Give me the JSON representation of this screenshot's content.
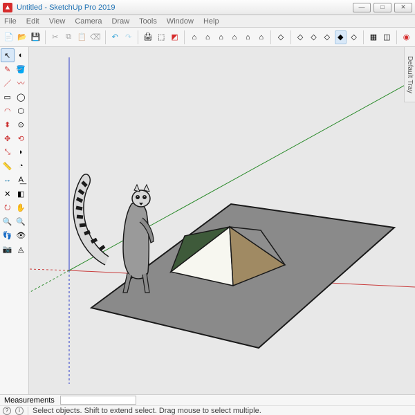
{
  "title": "Untitled - SketchUp Pro 2019",
  "menu": [
    "File",
    "Edit",
    "View",
    "Camera",
    "Draw",
    "Tools",
    "Window",
    "Help"
  ],
  "tray_label": "Default Tray",
  "measurements_label": "Measurements",
  "measurements_value": "",
  "status_hint": "Select objects. Shift to extend select. Drag mouse to select multiple.",
  "win_buttons": {
    "min": "—",
    "max": "□",
    "close": "✕"
  },
  "top_toolbar": [
    {
      "n": "new-icon",
      "g": "📄"
    },
    {
      "n": "open-icon",
      "g": "📂"
    },
    {
      "n": "save-icon",
      "g": "💾"
    },
    {
      "sep": true
    },
    {
      "n": "cut-icon",
      "g": "✂",
      "d": true
    },
    {
      "n": "copy-icon",
      "g": "⧉",
      "d": true
    },
    {
      "n": "paste-icon",
      "g": "📋",
      "d": true
    },
    {
      "n": "erase-icon",
      "g": "⌫",
      "d": true
    },
    {
      "sep": true
    },
    {
      "n": "undo-icon",
      "g": "↶",
      "c": "#2a9fd6"
    },
    {
      "n": "redo-icon",
      "g": "↷",
      "c": "#2a9fd6",
      "d": true
    },
    {
      "sep": true
    },
    {
      "n": "print-icon",
      "g": "🖨"
    },
    {
      "n": "model-info-icon",
      "g": "⬚"
    },
    {
      "n": "extension-icon",
      "g": "◩",
      "c": "#d62c2c"
    },
    {
      "sep": true
    },
    {
      "n": "warehouse-icon",
      "g": "⌂"
    },
    {
      "n": "3dwarehouse-icon",
      "g": "⌂"
    },
    {
      "n": "ext-warehouse-icon",
      "g": "⌂"
    },
    {
      "n": "component-icon",
      "g": "⌂"
    },
    {
      "n": "send-layout-icon",
      "g": "⌂"
    },
    {
      "n": "add-location-icon",
      "g": "⌂"
    },
    {
      "sep": true
    },
    {
      "n": "solid-tools-1-icon",
      "g": "◇"
    },
    {
      "sep": true
    },
    {
      "n": "solid-union-icon",
      "g": "◇"
    },
    {
      "n": "solid-subtract-icon",
      "g": "◇"
    },
    {
      "n": "solid-trim-icon",
      "g": "◇"
    },
    {
      "n": "solid-intersect-icon",
      "g": "◆",
      "a": true
    },
    {
      "n": "solid-split-icon",
      "g": "◇"
    },
    {
      "sep": true
    },
    {
      "n": "outer-shell-icon",
      "g": "▦"
    },
    {
      "n": "explode-icon",
      "g": "◫"
    },
    {
      "sep": true
    },
    {
      "n": "styles-icon",
      "g": "◉",
      "c": "#d62c2c"
    }
  ],
  "toolbox": [
    {
      "n": "select-tool-icon",
      "g": "↖",
      "sel": true
    },
    {
      "n": "lasso-tool-icon",
      "g": "◐"
    },
    {
      "n": "eraser-tool-icon",
      "g": "✎",
      "c": "#c33"
    },
    {
      "n": "paint-tool-icon",
      "g": "🪣"
    },
    {
      "n": "line-tool-icon",
      "g": "／",
      "c": "#c33"
    },
    {
      "n": "freehand-tool-icon",
      "g": "〰",
      "c": "#c33"
    },
    {
      "n": "rectangle-tool-icon",
      "g": "▭"
    },
    {
      "n": "circle-tool-icon",
      "g": "◯"
    },
    {
      "n": "arc-tool-icon",
      "g": "◠",
      "c": "#c33"
    },
    {
      "n": "polygon-tool-icon",
      "g": "⬡"
    },
    {
      "n": "pushpull-tool-icon",
      "g": "⬍",
      "c": "#c33"
    },
    {
      "n": "offset-tool-icon",
      "g": "⊙"
    },
    {
      "n": "move-tool-icon",
      "g": "✥",
      "c": "#c33"
    },
    {
      "n": "rotate-tool-icon",
      "g": "⟲",
      "c": "#c33"
    },
    {
      "n": "scale-tool-icon",
      "g": "⤡",
      "c": "#c33"
    },
    {
      "n": "followme-tool-icon",
      "g": "◗"
    },
    {
      "n": "tape-tool-icon",
      "g": "📏",
      "c": "#caa520"
    },
    {
      "n": "protractor-tool-icon",
      "g": "◔"
    },
    {
      "n": "dimension-tool-icon",
      "g": "↔",
      "c": "#17a"
    },
    {
      "n": "text-tool-icon",
      "g": "A͟"
    },
    {
      "n": "axes-tool-icon",
      "g": "✕"
    },
    {
      "n": "section-tool-icon",
      "g": "◧"
    },
    {
      "n": "orbit-tool-icon",
      "g": "⭮",
      "c": "#c33"
    },
    {
      "n": "pan-tool-icon",
      "g": "✋"
    },
    {
      "n": "zoom-tool-icon",
      "g": "🔍"
    },
    {
      "n": "zoom-extents-tool-icon",
      "g": "🔍"
    },
    {
      "n": "walk-tool-icon",
      "g": "👣"
    },
    {
      "n": "lookaround-tool-icon",
      "g": "👁"
    },
    {
      "n": "position-camera-tool-icon",
      "g": "📷"
    },
    {
      "n": "sandbox-tool-icon",
      "g": "◬"
    }
  ]
}
